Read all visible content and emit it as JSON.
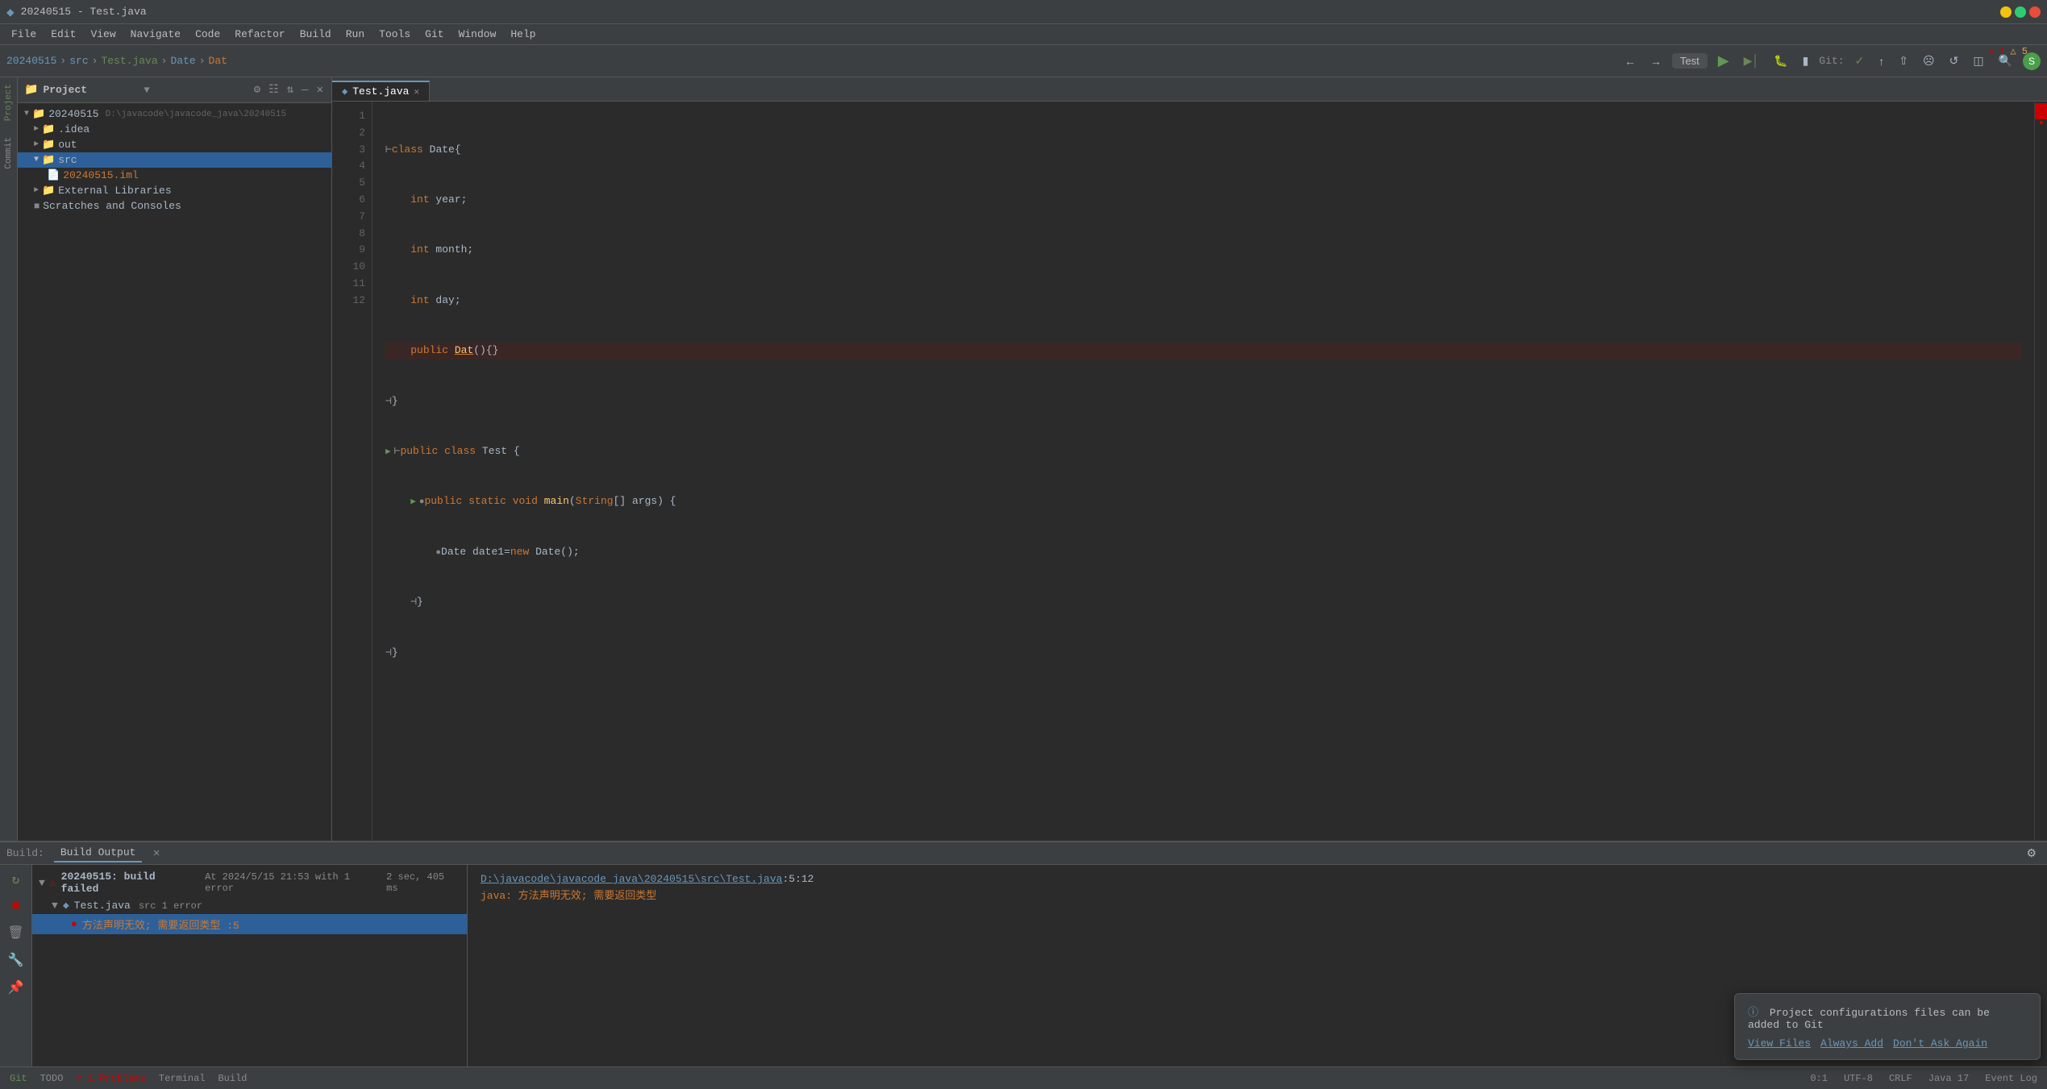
{
  "window": {
    "title": "20240515 - Test.java"
  },
  "menu": {
    "items": [
      "File",
      "Edit",
      "View",
      "Navigate",
      "Code",
      "Refactor",
      "Build",
      "Run",
      "Tools",
      "Git",
      "Window",
      "Help"
    ]
  },
  "toolbar": {
    "breadcrumb": [
      "20240515",
      "src",
      "Test.java",
      "Date",
      "Dat"
    ],
    "run_config": "Test",
    "git_label": "Git:"
  },
  "project_panel": {
    "title": "Project",
    "root": "20240515",
    "root_path": "D:\\javacode\\javacode_java\\20240515",
    "items": [
      {
        "label": ".idea",
        "type": "folder",
        "level": 1,
        "expanded": false
      },
      {
        "label": "out",
        "type": "folder",
        "level": 1,
        "expanded": false
      },
      {
        "label": "src",
        "type": "folder",
        "level": 1,
        "expanded": true,
        "selected": true
      },
      {
        "label": "20240515.iml",
        "type": "iml",
        "level": 2
      },
      {
        "label": "External Libraries",
        "type": "folder",
        "level": 1,
        "expanded": false
      },
      {
        "label": "Scratches and Consoles",
        "type": "folder",
        "level": 1,
        "expanded": false
      }
    ]
  },
  "editor": {
    "tab_label": "Test.java",
    "tab_icon": "java-icon",
    "code_lines": [
      {
        "num": 1,
        "text": "class Date{",
        "tokens": [
          {
            "t": "kw",
            "v": "class"
          },
          {
            "t": "sp",
            "v": " "
          },
          {
            "t": "cn",
            "v": "Date"
          },
          {
            "t": "br",
            "v": "{"
          }
        ]
      },
      {
        "num": 2,
        "text": "    int year;",
        "tokens": [
          {
            "t": "sp",
            "v": "    "
          },
          {
            "t": "kw",
            "v": "int"
          },
          {
            "t": "sp",
            "v": " year;"
          }
        ]
      },
      {
        "num": 3,
        "text": "    int month;",
        "tokens": [
          {
            "t": "sp",
            "v": "    "
          },
          {
            "t": "kw",
            "v": "int"
          },
          {
            "t": "sp",
            "v": " month;"
          }
        ]
      },
      {
        "num": 4,
        "text": "    int day;",
        "tokens": [
          {
            "t": "sp",
            "v": "    "
          },
          {
            "t": "kw",
            "v": "int"
          },
          {
            "t": "sp",
            "v": " day;"
          }
        ]
      },
      {
        "num": 5,
        "text": "    public Dat(){}",
        "tokens": [
          {
            "t": "sp",
            "v": "    "
          },
          {
            "t": "kw",
            "v": "public"
          },
          {
            "t": "sp",
            "v": " "
          },
          {
            "t": "fn",
            "v": "Dat"
          },
          {
            "t": "sp",
            "v": "(){}"
          }
        ],
        "error": true
      },
      {
        "num": 6,
        "text": "}",
        "tokens": [
          {
            "t": "sp",
            "v": "}"
          }
        ]
      },
      {
        "num": 7,
        "text": "public class Test {",
        "tokens": [
          {
            "t": "kw",
            "v": "public"
          },
          {
            "t": "sp",
            "v": " "
          },
          {
            "t": "kw",
            "v": "class"
          },
          {
            "t": "sp",
            "v": " "
          },
          {
            "t": "cn",
            "v": "Test"
          },
          {
            "t": "sp",
            "v": " {"
          }
        ],
        "runnable": true
      },
      {
        "num": 8,
        "text": "    public static void main(String[] args) {",
        "tokens": [
          {
            "t": "sp",
            "v": "    "
          },
          {
            "t": "kw",
            "v": "public"
          },
          {
            "t": "sp",
            "v": " "
          },
          {
            "t": "kw",
            "v": "static"
          },
          {
            "t": "sp",
            "v": " "
          },
          {
            "t": "kw",
            "v": "void"
          },
          {
            "t": "sp",
            "v": " "
          },
          {
            "t": "fn",
            "v": "main"
          },
          {
            "t": "sp",
            "v": "("
          },
          {
            "t": "kw",
            "v": "String"
          },
          {
            "t": "sp",
            "v": "[] args) {"
          }
        ],
        "runnable": true
      },
      {
        "num": 9,
        "text": "        Date date1=new Date();",
        "tokens": [
          {
            "t": "sp",
            "v": "        "
          },
          {
            "t": "cn",
            "v": "Date"
          },
          {
            "t": "sp",
            "v": " date1="
          },
          {
            "t": "kw",
            "v": "new"
          },
          {
            "t": "sp",
            "v": " "
          },
          {
            "t": "cn",
            "v": "Date"
          },
          {
            "t": "sp",
            "v": "();"
          }
        ]
      },
      {
        "num": 10,
        "text": "    }",
        "tokens": [
          {
            "t": "sp",
            "v": "    }"
          }
        ]
      },
      {
        "num": 11,
        "text": "}",
        "tokens": [
          {
            "t": "sp",
            "v": "}"
          }
        ]
      },
      {
        "num": 12,
        "text": "",
        "tokens": []
      }
    ],
    "error_count": 1,
    "warning_count": 5
  },
  "build_panel": {
    "label": "Build",
    "tab_label": "Build Output",
    "tree": {
      "root": {
        "label": "20240515: build failed",
        "detail": "At 2024/5/15 21:53 with 1 error",
        "time": "2 sec, 405 ms",
        "children": [
          {
            "label": "Test.java",
            "detail": "src 1 error",
            "children": [
              {
                "label": "方法声明无效; 需要返回类型 :5",
                "type": "error",
                "selected": true
              }
            ]
          }
        ]
      }
    },
    "output": {
      "file_link": "D:\\javacode\\javacode_java\\20240515\\src\\Test.java",
      "location": ":5:12",
      "message": "java: 方法声明无效; 需要返回类型"
    }
  },
  "bottom_tabs": [
    "Git",
    "TODO",
    "Problems",
    "Terminal",
    "Build"
  ],
  "status_bar": {
    "git_branch": "Git",
    "todo_label": "TODO",
    "problems_label": "Problems",
    "problems_error": 1,
    "terminal_label": "Terminal",
    "build_label": "Build",
    "right_items": [
      "0:1",
      "UTF-8",
      "CRLF",
      "Java 17",
      "Event Log"
    ]
  },
  "git_notification": {
    "text": "Project configurations files can be added to Git",
    "actions": [
      "View Files",
      "Always Add",
      "Don't Ask Again"
    ]
  }
}
